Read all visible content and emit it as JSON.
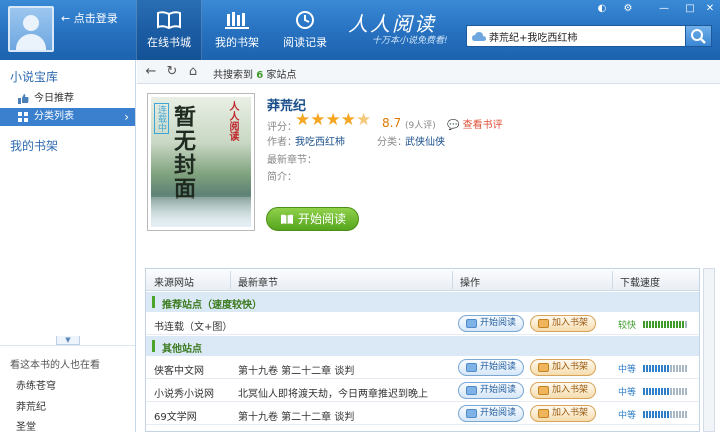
{
  "header": {
    "login_label": "点击登录",
    "tabs": [
      {
        "label": "在线书城",
        "icon": "open-book-icon",
        "active": true
      },
      {
        "label": "我的书架",
        "icon": "bookshelf-icon",
        "active": false
      },
      {
        "label": "阅读记录",
        "icon": "clock-icon",
        "active": false
      }
    ],
    "brand": "人人阅读",
    "slogan": "十万本小说免费看!",
    "search_value": "莽荒纪+我吃西红柿"
  },
  "sidebar": {
    "section_title": "小说宝库",
    "items": [
      {
        "label": "今日推荐",
        "icon": "thumbs-up-icon",
        "selected": false
      },
      {
        "label": "分类列表",
        "icon": "grid-icon",
        "selected": true
      }
    ],
    "bookshelf_title": "我的书架",
    "also_read_title": "看这本书的人也在看",
    "also_read": [
      "赤练苍穹",
      "莽荒纪",
      "圣堂"
    ]
  },
  "toolbar": {
    "found_prefix": "共搜索到",
    "found_count": "6",
    "found_suffix": "家站点"
  },
  "book": {
    "title": "莽荒纪",
    "cover_main": "暂无封面",
    "cover_left": "连载中",
    "cover_right": "人人阅读",
    "rating_label": "评分：",
    "rating": 4.5,
    "score": "8.7",
    "votes": "(9人评)",
    "review_label": "查看书评",
    "author_label": "作者：",
    "author": "我吃西红柿",
    "category_label": "分类：",
    "category": "武侠仙侠",
    "latest_label": "最新章节：",
    "intro_label": "简介：",
    "start_label": "开始阅读"
  },
  "table": {
    "headers": [
      "来源网站",
      "最新章节",
      "操作",
      "下载速度"
    ],
    "read_label": "开始阅读",
    "add_label": "加入书架",
    "groups": [
      {
        "title": "推荐站点（速度较快）",
        "rows": [
          {
            "site": "书连载（文+图）",
            "chapter": "",
            "speed": "较快",
            "speed_color": "#3d9b2a",
            "speed_level": 0.95
          }
        ]
      },
      {
        "title": "其他站点",
        "rows": [
          {
            "site": "侠客中文网",
            "chapter": "第十九卷 第二十二章 谈判",
            "speed": "中等",
            "speed_color": "#2f7fc8",
            "speed_level": 0.6
          },
          {
            "site": "小说秀小说网",
            "chapter": "北冥仙人即将渡天劫，今日两章推迟到晚上",
            "speed": "中等",
            "speed_color": "#2f7fc8",
            "speed_level": 0.6
          },
          {
            "site": "69文学网",
            "chapter": "第十九卷 第二十二章 谈判",
            "speed": "中等",
            "speed_color": "#2f7fc8",
            "speed_level": 0.6
          }
        ]
      }
    ]
  }
}
